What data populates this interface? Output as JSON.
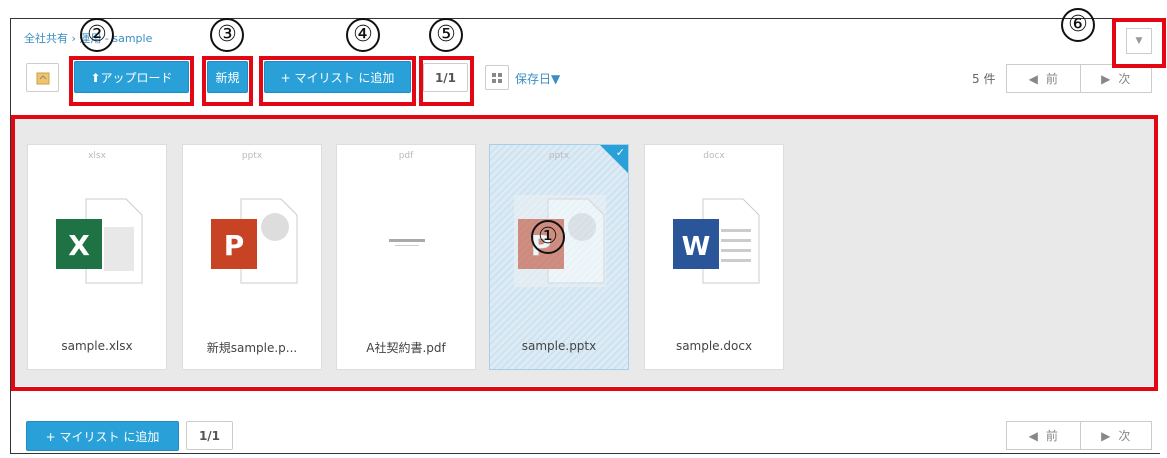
{
  "breadcrumb": "全社共有 › 運用 - sample",
  "toolbar": {
    "upload_label": "⬆アップロード",
    "new_label": "新規",
    "add_mylist_label": "+ マイリスト に追加",
    "page_indicator": "1/1",
    "sort_label": "保存日▼",
    "count_label": "5 件",
    "prev_label": "前",
    "next_label": "次"
  },
  "callout_numbers": [
    "①",
    "②",
    "③",
    "④",
    "⑤",
    "⑥"
  ],
  "files": [
    {
      "ext": "xlsx",
      "name": "sample.xlsx",
      "icon": "excel-file-icon",
      "letter": "X",
      "color": "#1f7244",
      "selected": false
    },
    {
      "ext": "pptx",
      "name": "新規sample.p...",
      "icon": "powerpoint-file-icon",
      "letter": "P",
      "color": "#c84323",
      "selected": false
    },
    {
      "ext": "pdf",
      "name": "A社契約書.pdf",
      "icon": "pdf-thumbnail",
      "letter": "",
      "color": "#999999",
      "selected": false
    },
    {
      "ext": "pptx",
      "name": "sample.pptx",
      "icon": "powerpoint-file-icon",
      "letter": "P",
      "color": "#c84323",
      "selected": true
    },
    {
      "ext": "docx",
      "name": "sample.docx",
      "icon": "word-file-icon",
      "letter": "W",
      "color": "#2a5599",
      "selected": false
    }
  ],
  "bottom": {
    "add_mylist_label": "+ マイリスト に追加",
    "page_indicator": "1/1",
    "prev_label": "前",
    "next_label": "次"
  },
  "colors": {
    "accent": "#2aa0d8",
    "callout": "#e30613"
  }
}
